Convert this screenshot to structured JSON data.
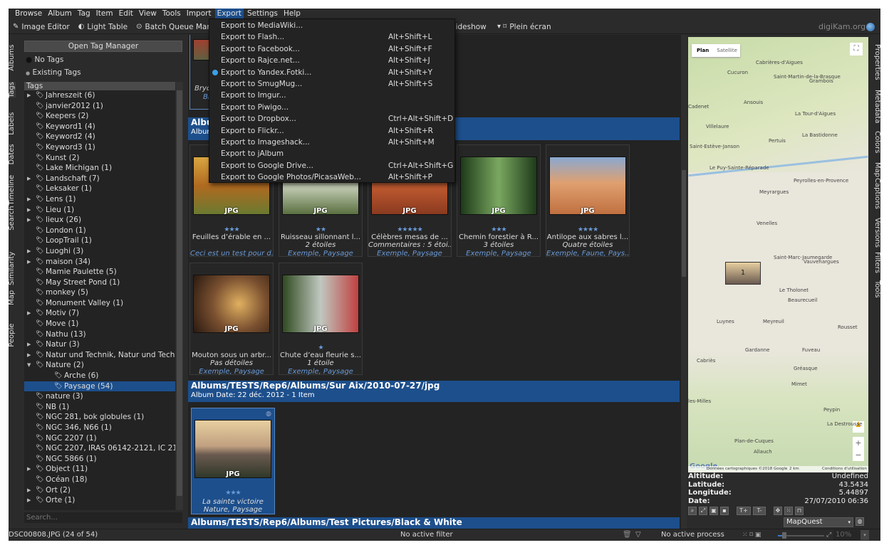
{
  "menubar": [
    "Browse",
    "Album",
    "Tag",
    "Item",
    "Edit",
    "View",
    "Tools",
    "Import",
    "Export",
    "Settings",
    "Help"
  ],
  "active_menu": "Export",
  "toolbar": {
    "image_editor": "Image Editor",
    "light_table": "Light Table",
    "batch_queue": "Batch Queue Manage",
    "slideshow": "Slideshow",
    "fullscreen": "Plein écran",
    "brand": "digiKam.org"
  },
  "left_tabs": [
    "Albums",
    "Tags",
    "Labels",
    "Dates",
    "Timeline",
    "Search",
    "Similarity",
    "Map",
    "People"
  ],
  "right_tabs": [
    "Properties",
    "Metadata",
    "Colors",
    "Map",
    "Captions",
    "Versions",
    "Filters",
    "Tools"
  ],
  "tags_panel": {
    "open_manager": "Open Tag Manager",
    "no_tags": "No Tags",
    "existing_tags": "Existing Tags",
    "header": "Tags",
    "search_placeholder": "Search...",
    "items": [
      {
        "label": "Jahreszeit (6)",
        "exp": true
      },
      {
        "label": "janvier2012 (1)"
      },
      {
        "label": "Keepers (2)"
      },
      {
        "label": "Keyword1 (4)"
      },
      {
        "label": "Keyword2 (4)"
      },
      {
        "label": "Keyword3 (1)"
      },
      {
        "label": "Kunst (2)"
      },
      {
        "label": "Lake Michigan (1)"
      },
      {
        "label": "Landschaft (7)",
        "exp": true
      },
      {
        "label": "Leksaker (1)"
      },
      {
        "label": "Lens (1)",
        "exp": true
      },
      {
        "label": "Lieu (1)",
        "exp": true
      },
      {
        "label": "lieux (26)",
        "exp": true
      },
      {
        "label": "London (1)"
      },
      {
        "label": "LoopTrail (1)"
      },
      {
        "label": "Luoghi (3)",
        "exp": true
      },
      {
        "label": "maison (34)",
        "exp": true
      },
      {
        "label": "Mamie Paulette (5)"
      },
      {
        "label": "May Street Pond (1)"
      },
      {
        "label": "monkey (5)"
      },
      {
        "label": "Monument Valley (1)"
      },
      {
        "label": "Motiv (7)",
        "exp": true
      },
      {
        "label": "Move (1)"
      },
      {
        "label": "Nathu (13)"
      },
      {
        "label": "Natur (3)",
        "exp": true
      },
      {
        "label": "Natur und Technik, Natur und Technik",
        "exp": true
      },
      {
        "label": "Nature (2)",
        "open": true
      },
      {
        "label": "Arche (6)",
        "child": true
      },
      {
        "label": "Paysage (54)",
        "child": true,
        "selected": true
      },
      {
        "label": "nature (3)"
      },
      {
        "label": "NB (1)"
      },
      {
        "label": "NGC 281, bok globules (1)"
      },
      {
        "label": "NGC 346, N66 (1)"
      },
      {
        "label": "NGC 2207 (1)"
      },
      {
        "label": "NGC 2207, IRAS 06142-2121, IC 2163"
      },
      {
        "label": "NGC 5866 (1)"
      },
      {
        "label": "Object (11)",
        "exp": true
      },
      {
        "label": "Océan (18)"
      },
      {
        "label": "Ort (2)",
        "exp": true
      },
      {
        "label": "Orte (1)",
        "exp": true
      }
    ]
  },
  "export_menu": [
    {
      "label": "Export to MediaWiki...",
      "shortcut": ""
    },
    {
      "label": "Export to Flash...",
      "shortcut": "Alt+Shift+L"
    },
    {
      "label": "Export to Facebook...",
      "shortcut": "Alt+Shift+F"
    },
    {
      "label": "Export to Rajce.net...",
      "shortcut": "Alt+Shift+J"
    },
    {
      "label": "Export to Yandex.Fotki...",
      "shortcut": "Alt+Shift+Y",
      "icon": "globe"
    },
    {
      "label": "Export to SmugMug...",
      "shortcut": "Alt+Shift+S"
    },
    {
      "label": "Export to Imgur...",
      "shortcut": ""
    },
    {
      "label": "Export to Piwigo...",
      "shortcut": ""
    },
    {
      "label": "Export to Dropbox...",
      "shortcut": "Ctrl+Alt+Shift+D"
    },
    {
      "label": "Export to Flickr...",
      "shortcut": "Alt+Shift+R"
    },
    {
      "label": "Export to Imageshack...",
      "shortcut": "Alt+Shift+M"
    },
    {
      "label": "Export to jAlbum",
      "shortcut": ""
    },
    {
      "label": "Export to Google Drive...",
      "shortcut": "Ctrl+Alt+Shift+G"
    },
    {
      "label": "Export to Google Photos/PicasaWeb...",
      "shortcut": "Alt+Shift+P"
    }
  ],
  "content": {
    "partial_tile": {
      "c1": "Bryc",
      "c3": "Br"
    },
    "group1": {
      "title": "Albu",
      "sub": "Albur"
    },
    "tiles": [
      {
        "type": "JPG",
        "stars": 3,
        "c1": "Feuilles d’érable en ...",
        "c2": "",
        "c3": "Ceci est un test pour d...",
        "img": "linear-gradient(#d9a640,#b06a20 50%,#6a7a30)"
      },
      {
        "type": "JPG",
        "stars": 2,
        "c1": "Ruisseau sillonnant l...",
        "c2": "2 étoiles",
        "c3": "Exemple, Paysage",
        "img": "linear-gradient(#6a8a50,#c8d0b8 50%,#5a7040)"
      },
      {
        "type": "JPG",
        "stars": 5,
        "c1": "Célèbres mesas de ...",
        "c2": "Commentaires : 5 étoi...",
        "c3": "Exemple, Paysage",
        "img": "linear-gradient(#e0b080,#c05a30 50%,#8a3a20)"
      },
      {
        "type": "JPG",
        "stars": 3,
        "c1": "Chemin forestier à R...",
        "c2": "3 étoiles",
        "c3": "Exemple, Paysage",
        "img": "linear-gradient(90deg,#1e3a1a,#7aa860 50%,#1e3a1a)"
      },
      {
        "type": "JPG",
        "stars": 4,
        "c1": "Antilope aux sabres l...",
        "c2": "Quatre étoiles",
        "c3": "Exemple, Faune, Pays...",
        "img": "linear-gradient(#8aa8d0,#e0a070 45%,#c07040)"
      },
      {
        "type": "JPG",
        "stars": 0,
        "c1": "Mouton sous un arbr...",
        "c2": "Pas détoiles",
        "c3": "Exemple, Paysage",
        "img": "radial-gradient(circle at 60% 50%,#e0b060,#7a5030 50%,#2a1a10)"
      },
      {
        "type": "JPG",
        "stars": 1,
        "c1": "Chute d’eau fleurie s...",
        "c2": "1 étoile",
        "c3": "Exemple, Paysage",
        "img": "linear-gradient(90deg,#304a20,#c0c8c0 50%,#c04040)"
      }
    ],
    "group2": {
      "title": "Albums/TESTS/Rep6/Albums/Sur Aix/2010-07-27/jpg",
      "sub": "Album Date: 22 déc. 2012 - 1 Item"
    },
    "tile_sel": {
      "type": "JPG",
      "stars": 3,
      "c1": "La sainte victoire",
      "c2": "Nature, Paysage"
    },
    "group3": {
      "title": "Albums/TESTS/Rep6/Albums/Test Pictures/Black & White"
    }
  },
  "map": {
    "plan": "Plan",
    "satellite": "Satellite",
    "marker_count": "1",
    "attribution": "Données cartographiques ©2018 Google",
    "scale": "2 km",
    "terms": "Conditions d'utilisation",
    "google": "Google",
    "places": [
      "Cabrières-d'Aigues",
      "Cucuron",
      "Saint-Martin-de-la-Brasque",
      "Grambois",
      "Cadenet",
      "Ansouis",
      "Villelaure",
      "La Tour-d'Aigues",
      "Pertuis",
      "La Bastidonne",
      "Saint-Estève-Janson",
      "Le Puy-Sainte-Réparade",
      "Peyrolles-en-Provence",
      "Meyrargues",
      "Venelles",
      "Saint-Marc-Jaumegarde",
      "Vauvenargues",
      "Le Tholonet",
      "Beaurecueil",
      "Luynes",
      "Meyreuil",
      "Rousset",
      "Gardanne",
      "Fuveau",
      "Gréasque",
      "Cabriès",
      "Mimet",
      "les-Milles",
      "Peypin",
      "La Destrousse",
      "Plan-de-Cuques",
      "Allauch"
    ]
  },
  "info": {
    "altitude_label": "Altitude:",
    "altitude": "Undefined",
    "latitude_label": "Latitude:",
    "latitude": "43.5434",
    "longitude_label": "Longitude:",
    "longitude": "5.44897",
    "date_label": "Date:",
    "date": "27/07/2010 06:36",
    "tplus": "T+",
    "tminus": "T-",
    "provider": "MapQuest"
  },
  "status": {
    "file": "DSC00808.JPG (24 of 54)",
    "filter": "No active filter",
    "process": "No active process",
    "zoom": "10%"
  },
  "colors": {
    "accent": "#1d4f8c",
    "background": "#2b2b2b",
    "link": "#6a9ad8"
  }
}
